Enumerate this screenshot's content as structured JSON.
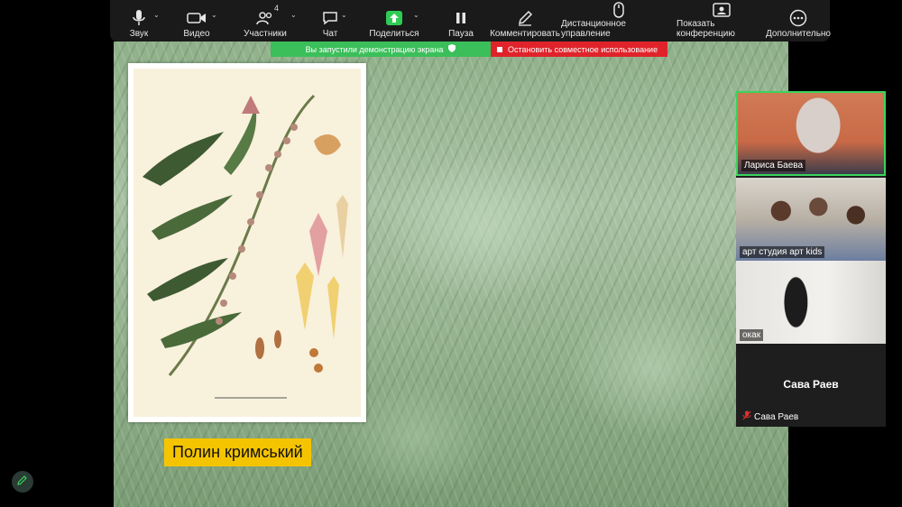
{
  "toolbar": {
    "items": [
      {
        "label": "Звук",
        "icon": "microphone-icon"
      },
      {
        "label": "Видео",
        "icon": "video-camera-icon"
      },
      {
        "label": "Участники",
        "icon": "participants-icon",
        "badge": "4"
      },
      {
        "label": "Чат",
        "icon": "chat-icon"
      },
      {
        "label": "Поделиться",
        "icon": "share-screen-icon"
      },
      {
        "label": "Пауза",
        "icon": "pause-icon"
      },
      {
        "label": "Комментировать",
        "icon": "annotate-pen-icon"
      },
      {
        "label": "Дистанционное управление",
        "icon": "mouse-icon"
      },
      {
        "label": "Показать конференцию",
        "icon": "show-meeting-icon"
      },
      {
        "label": "Дополнительно",
        "icon": "more-icon"
      }
    ]
  },
  "banner": {
    "sharing_text": "Вы запустили демонстрацию экрана",
    "stop_text": "Остановить совместное использование",
    "green": "#3bbf5a",
    "red": "#e0232b"
  },
  "shared_content": {
    "caption": "Полин кримський",
    "caption_color": "#f5c400"
  },
  "participants": [
    {
      "name": "Лариса Баева",
      "active_speaker": true
    },
    {
      "name": "арт студия арт kids"
    },
    {
      "name": "окак"
    },
    {
      "name": "Сава Раев",
      "display_name": "Сава Раев",
      "muted": true
    }
  ],
  "colors": {
    "active_speaker_border": "#3ad35b",
    "toolbar_bg": "#1a1a1a"
  }
}
